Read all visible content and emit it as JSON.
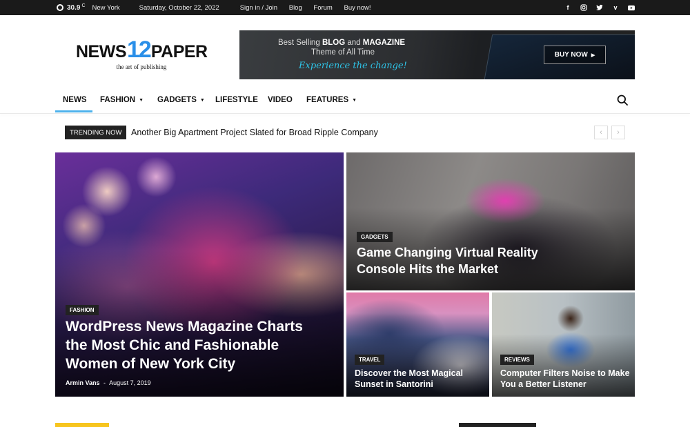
{
  "topbar": {
    "temperature": "30.9",
    "unit": "C",
    "city": "New York",
    "date": "Saturday, October 22, 2022",
    "links": [
      "Sign in / Join",
      "Blog",
      "Forum",
      "Buy now!"
    ],
    "socials": [
      "facebook-icon",
      "instagram-icon",
      "twitter-icon",
      "vimeo-icon",
      "youtube-icon"
    ]
  },
  "logo": {
    "part1": "NEWS",
    "part2": "12",
    "part3": "PAPER",
    "tagline": "the art of publishing"
  },
  "banner": {
    "line1_pre": "Best Selling ",
    "line1_bold": "BLOG",
    "line1_mid": " and ",
    "line1_bold2": "MAGAZINE",
    "line2": "Theme of All Time",
    "line3": "Experience the change!",
    "button": "BUY NOW"
  },
  "nav": {
    "items": [
      "NEWS",
      "FASHION",
      "GADGETS",
      "LIFESTYLE",
      "VIDEO",
      "FEATURES"
    ],
    "active": "NEWS"
  },
  "trending": {
    "label": "TRENDING NOW",
    "headline": "Another Big Apartment Project Slated for Broad Ripple Company"
  },
  "tiles": {
    "main": {
      "category": "FASHION",
      "title": "WordPress News Magazine Charts the Most Chic and Fashionable Women of New York City",
      "author": "Armin Vans",
      "separator": "-",
      "date": "August 7, 2019"
    },
    "vr": {
      "category": "GADGETS",
      "title": "Game Changing Virtual Reality Console Hits the Market"
    },
    "santorini": {
      "category": "TRAVEL",
      "title": "Discover the Most Magical Sunset in Santorini"
    },
    "reviews": {
      "category": "REVIEWS",
      "title": "Computer Filters Noise to Make You a Better Listener"
    }
  },
  "colors": {
    "accent": "#4db2ec",
    "logo_blue": "#2a8fe8",
    "yellow": "#f7c51e"
  }
}
